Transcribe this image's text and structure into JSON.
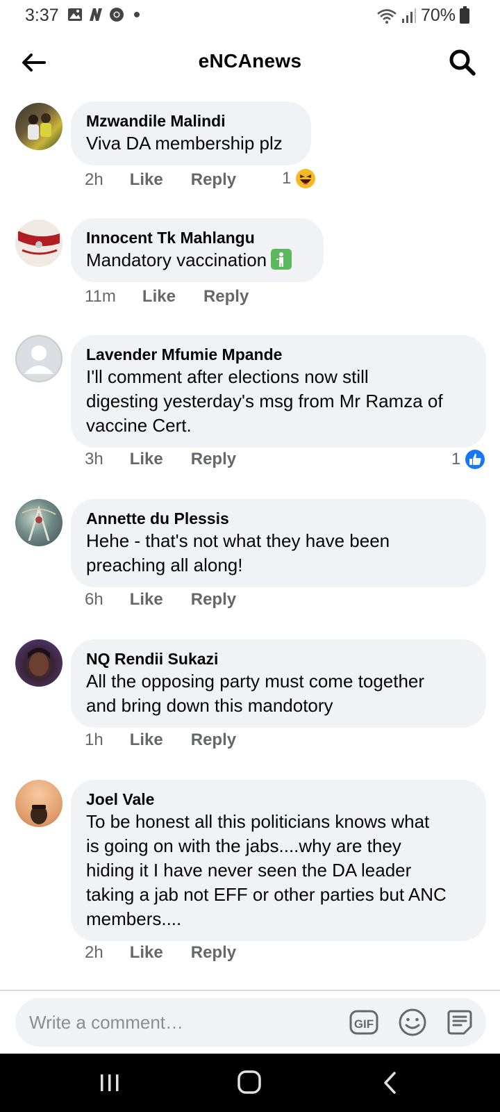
{
  "status": {
    "time": "3:37",
    "battery": "70%",
    "icons": [
      "gallery-icon",
      "n-app-icon",
      "chrome-icon",
      "notification-dot",
      "wifi-icon",
      "signal-icon",
      "battery-icon"
    ]
  },
  "header": {
    "title": "eNCAnews",
    "back_icon": "back-arrow-icon",
    "search_icon": "search-icon"
  },
  "comments": [
    {
      "author": "Mzwandile Malindi",
      "text": "Viva DA membership plz",
      "time": "2h",
      "like_label": "Like",
      "reply_label": "Reply",
      "reaction_count": "1",
      "reaction_icon": "haha-emoji-icon"
    },
    {
      "author": "Innocent Tk Mahlangu",
      "text": "Mandatory vaccination",
      "inline_emoji": "person-symbol-emoji",
      "time": "11m",
      "like_label": "Like",
      "reply_label": "Reply"
    },
    {
      "author": "Lavender Mfumie Mpande",
      "text_lines": [
        "I'll comment after elections now still",
        "digesting yesterday's msg from Mr Ramza of",
        "vaccine Cert."
      ],
      "time": "3h",
      "like_label": "Like",
      "reply_label": "Reply",
      "reaction_count": "1",
      "reaction_icon": "like-thumb-icon"
    },
    {
      "author": "Annette du Plessis",
      "text_lines": [
        "Hehe - that's not what they have been",
        "preaching all along!"
      ],
      "time": "6h",
      "like_label": "Like",
      "reply_label": "Reply"
    },
    {
      "author": "NQ Rendii Sukazi",
      "text_lines": [
        "All the opposing party must come together",
        "and bring down this mandotory"
      ],
      "time": "1h",
      "like_label": "Like",
      "reply_label": "Reply"
    },
    {
      "author": "Joel Vale",
      "text_lines": [
        "To be honest all this politicians knows what",
        "is going on with the jabs....why are they",
        "hiding it I have never seen the DA leader",
        "taking a jab not EFF or other parties but ANC",
        "members...."
      ],
      "time": "2h",
      "like_label": "Like",
      "reply_label": "Reply"
    }
  ],
  "composer": {
    "placeholder": "Write a comment…",
    "gif_label": "GIF",
    "icons": [
      "gif-icon",
      "emoji-icon",
      "sticker-icon"
    ]
  },
  "navbar": {
    "icons": [
      "recent-apps-icon",
      "home-icon",
      "back-icon"
    ]
  },
  "colors": {
    "bubble": "#f0f2f5",
    "meta_text": "#65676b",
    "like_blue": "#1877f2",
    "haha_yellow": "#f7b928"
  }
}
